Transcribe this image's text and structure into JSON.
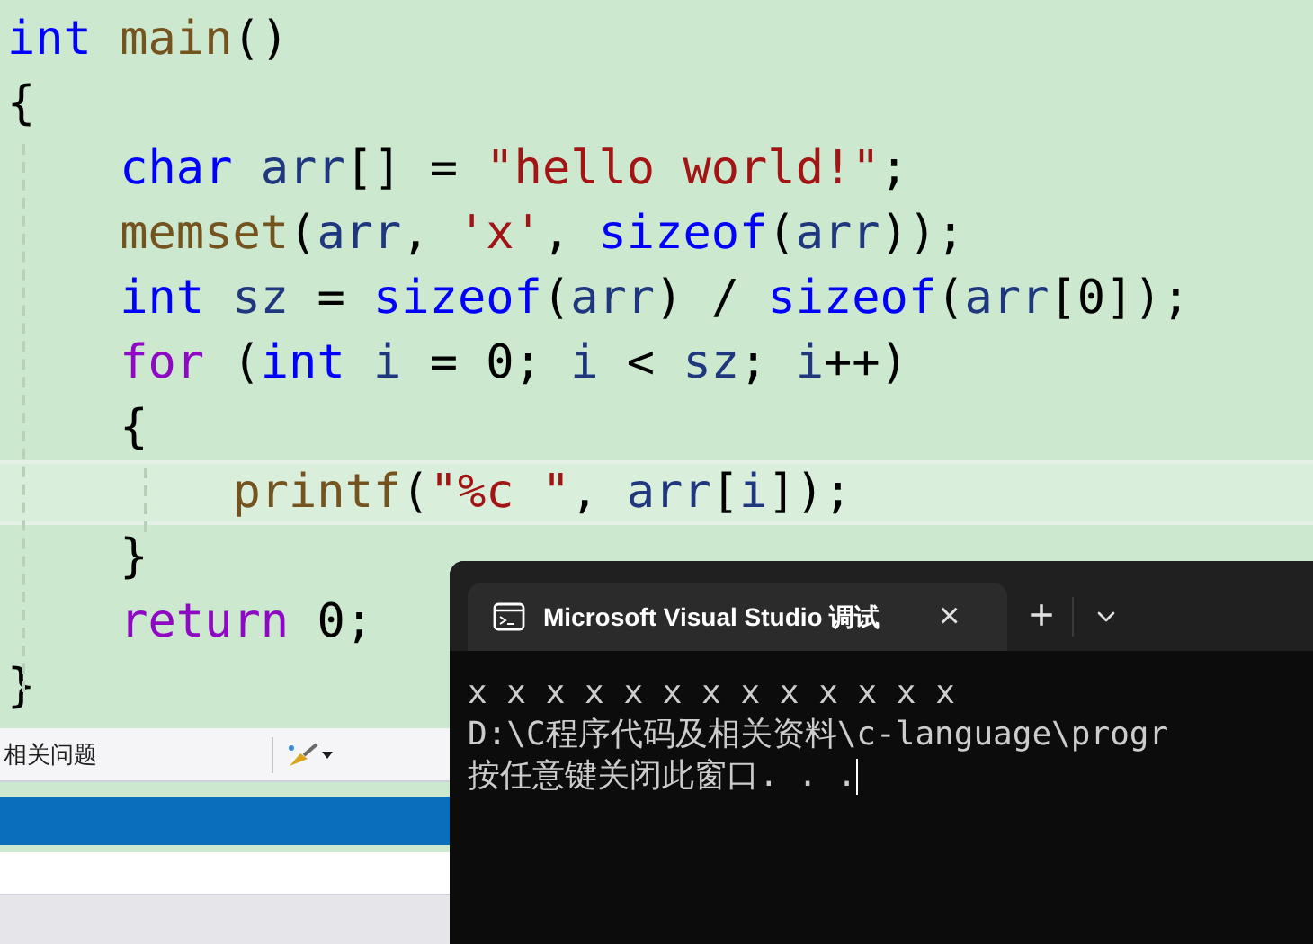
{
  "editor": {
    "lines": [
      {
        "current": false,
        "tokens": [
          {
            "text": "int ",
            "kind": "keyword"
          },
          {
            "text": "main",
            "kind": "function"
          },
          {
            "text": "()",
            "kind": "plain"
          }
        ]
      },
      {
        "current": false,
        "tokens": [
          {
            "text": "{",
            "kind": "plain"
          }
        ]
      },
      {
        "current": false,
        "tokens": [
          {
            "text": "    char ",
            "kind": "keyword"
          },
          {
            "text": "arr",
            "kind": "variable"
          },
          {
            "text": "[] = ",
            "kind": "plain"
          },
          {
            "text": "\"hello world!\"",
            "kind": "string"
          },
          {
            "text": ";",
            "kind": "plain"
          }
        ]
      },
      {
        "current": false,
        "tokens": [
          {
            "text": "    memset",
            "kind": "function"
          },
          {
            "text": "(",
            "kind": "plain"
          },
          {
            "text": "arr",
            "kind": "variable"
          },
          {
            "text": ", ",
            "kind": "plain"
          },
          {
            "text": "'x'",
            "kind": "string"
          },
          {
            "text": ", ",
            "kind": "plain"
          },
          {
            "text": "sizeof",
            "kind": "keyword"
          },
          {
            "text": "(",
            "kind": "plain"
          },
          {
            "text": "arr",
            "kind": "variable"
          },
          {
            "text": "));",
            "kind": "plain"
          }
        ]
      },
      {
        "current": false,
        "tokens": [
          {
            "text": "    int ",
            "kind": "keyword"
          },
          {
            "text": "sz",
            "kind": "variable"
          },
          {
            "text": " = ",
            "kind": "plain"
          },
          {
            "text": "sizeof",
            "kind": "keyword"
          },
          {
            "text": "(",
            "kind": "plain"
          },
          {
            "text": "arr",
            "kind": "variable"
          },
          {
            "text": ") / ",
            "kind": "plain"
          },
          {
            "text": "sizeof",
            "kind": "keyword"
          },
          {
            "text": "(",
            "kind": "plain"
          },
          {
            "text": "arr",
            "kind": "variable"
          },
          {
            "text": "[0]);",
            "kind": "plain"
          }
        ]
      },
      {
        "current": false,
        "tokens": [
          {
            "text": "    for",
            "kind": "control"
          },
          {
            "text": " (",
            "kind": "plain"
          },
          {
            "text": "int ",
            "kind": "keyword"
          },
          {
            "text": "i",
            "kind": "variable"
          },
          {
            "text": " = 0; ",
            "kind": "plain"
          },
          {
            "text": "i",
            "kind": "variable"
          },
          {
            "text": " < ",
            "kind": "plain"
          },
          {
            "text": "sz",
            "kind": "variable"
          },
          {
            "text": "; ",
            "kind": "plain"
          },
          {
            "text": "i",
            "kind": "variable"
          },
          {
            "text": "++)",
            "kind": "plain"
          }
        ]
      },
      {
        "current": false,
        "tokens": [
          {
            "text": "    {",
            "kind": "plain"
          }
        ]
      },
      {
        "current": true,
        "tokens": [
          {
            "text": "        printf",
            "kind": "function"
          },
          {
            "text": "(",
            "kind": "plain"
          },
          {
            "text": "\"%c \"",
            "kind": "string"
          },
          {
            "text": ", ",
            "kind": "plain"
          },
          {
            "text": "arr",
            "kind": "variable"
          },
          {
            "text": "[",
            "kind": "plain"
          },
          {
            "text": "i",
            "kind": "variable"
          },
          {
            "text": "]);",
            "kind": "plain"
          }
        ]
      },
      {
        "current": false,
        "tokens": [
          {
            "text": "    }",
            "kind": "plain"
          }
        ]
      },
      {
        "current": false,
        "tokens": [
          {
            "text": "    return",
            "kind": "control"
          },
          {
            "text": " 0;",
            "kind": "plain"
          }
        ]
      },
      {
        "current": false,
        "tokens": [
          {
            "text": "}",
            "kind": "plain"
          }
        ]
      }
    ]
  },
  "output_panel": {
    "message": "相关问题",
    "rows": [
      {
        "selected": true
      },
      {
        "selected": false
      }
    ]
  },
  "terminal": {
    "tab_title": "Microsoft Visual Studio 调试",
    "close": "×",
    "new_tab": "+",
    "lines": [
      "x x x x x x x x x x x x x",
      "D:\\C程序代码及相关资料\\c-language\\progr",
      "按任意键关闭此窗口. . ."
    ]
  }
}
